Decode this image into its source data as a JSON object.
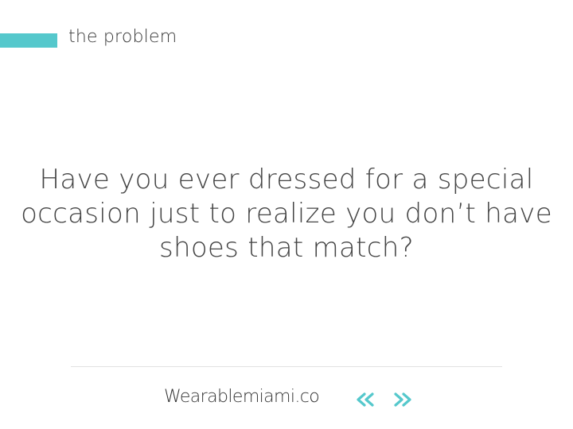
{
  "header": {
    "section_title": "the problem"
  },
  "main": {
    "headline_lines": [
      "Have you ever dressed for a special",
      "occasion just to realize you don’t have",
      "shoes that match?"
    ]
  },
  "footer": {
    "brand": "Wearablemiami.co",
    "prev_icon": "double-chevron-left-icon",
    "next_icon": "double-chevron-right-icon"
  },
  "colors": {
    "accent": "#55c8cc",
    "text": "#3d3d3d",
    "divider": "#e2e2e2"
  }
}
